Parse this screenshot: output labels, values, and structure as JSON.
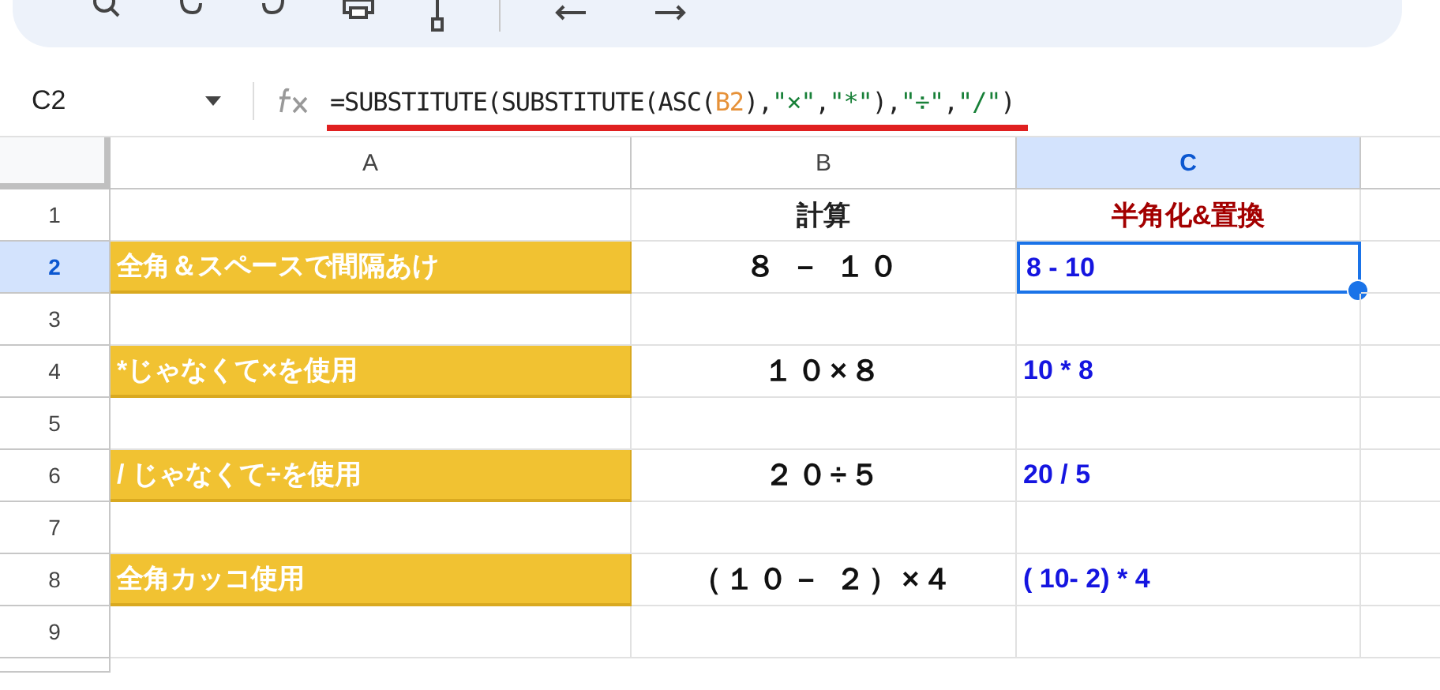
{
  "name_box": {
    "value": "C2"
  },
  "formula": {
    "parts": [
      {
        "text": "=SUBSTITUTE(SUBSTITUTE(ASC(",
        "kind": "plain"
      },
      {
        "text": "B2",
        "kind": "ref"
      },
      {
        "text": "),",
        "kind": "plain"
      },
      {
        "text": "\"×\"",
        "kind": "string"
      },
      {
        "text": ",",
        "kind": "plain"
      },
      {
        "text": "\"*\"",
        "kind": "string"
      },
      {
        "text": "),",
        "kind": "plain"
      },
      {
        "text": "\"÷\"",
        "kind": "string"
      },
      {
        "text": ",",
        "kind": "plain"
      },
      {
        "text": "\"/\"",
        "kind": "string"
      },
      {
        "text": ")",
        "kind": "plain"
      }
    ],
    "underlined": true
  },
  "columns": [
    {
      "label": "A",
      "selected": false
    },
    {
      "label": "B",
      "selected": false
    },
    {
      "label": "C",
      "selected": true
    }
  ],
  "rows": [
    {
      "number": "1",
      "selected": false,
      "cells": [
        null,
        {
          "text": "計算",
          "kind": "header"
        },
        {
          "text": "半角化&置換",
          "kind": "title"
        }
      ]
    },
    {
      "number": "2",
      "selected": true,
      "cells": [
        {
          "text": "全角＆スペースで間隔あけ",
          "kind": "label"
        },
        {
          "text": "８ － １０",
          "kind": "calc"
        },
        {
          "text": "8 - 10",
          "kind": "result",
          "selected": true
        }
      ]
    },
    {
      "number": "3",
      "selected": false,
      "cells": [
        null,
        null,
        null
      ]
    },
    {
      "number": "4",
      "selected": false,
      "cells": [
        {
          "text": "*じゃなくて×を使用",
          "kind": "label"
        },
        {
          "text": "１０×８",
          "kind": "calc"
        },
        {
          "text": "10 * 8",
          "kind": "result",
          "selected": false
        }
      ]
    },
    {
      "number": "5",
      "selected": false,
      "cells": [
        null,
        null,
        null
      ]
    },
    {
      "number": "6",
      "selected": false,
      "cells": [
        {
          "text": "/ じゃなくて÷を使用",
          "kind": "label"
        },
        {
          "text": "２０÷５",
          "kind": "calc"
        },
        {
          "text": "20 / 5",
          "kind": "result",
          "selected": false
        }
      ]
    },
    {
      "number": "7",
      "selected": false,
      "cells": [
        null,
        null,
        null
      ]
    },
    {
      "number": "8",
      "selected": false,
      "cells": [
        {
          "text": "全角カッコ使用",
          "kind": "label"
        },
        {
          "text": "（１０－ ２）×４",
          "kind": "calc"
        },
        {
          "text": "( 10- 2) * 4",
          "kind": "result",
          "selected": false
        }
      ]
    },
    {
      "number": "9",
      "selected": false,
      "cells": [
        null,
        null,
        null
      ]
    }
  ]
}
